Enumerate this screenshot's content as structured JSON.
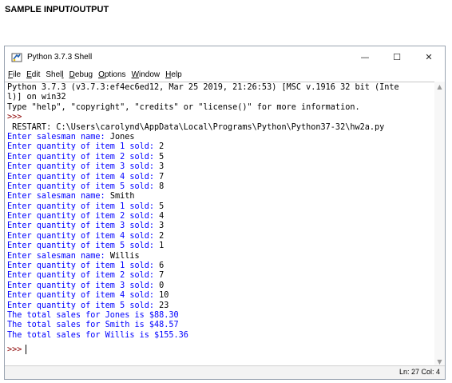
{
  "page_heading": "SAMPLE INPUT/OUTPUT",
  "window": {
    "title": "Python 3.7.3 Shell",
    "controls": {
      "minimize": "—",
      "maximize": "☐",
      "close": "✕"
    }
  },
  "menu": [
    {
      "u": "F",
      "rest": "ile"
    },
    {
      "u": "E",
      "rest": "dit"
    },
    {
      "u": "",
      "pre": "She",
      "u2": "l",
      "rest": "l"
    },
    {
      "u": "D",
      "rest": "ebug"
    },
    {
      "u": "O",
      "rest": "ptions"
    },
    {
      "u": "W",
      "rest": "indow"
    },
    {
      "u": "H",
      "rest": "elp"
    }
  ],
  "menu_labels": [
    "File",
    "Edit",
    "Shell",
    "Debug",
    "Options",
    "Window",
    "Help"
  ],
  "shell": {
    "lines": [
      {
        "t": "Python 3.7.3 (v3.7.3:ef4ec6ed12, Mar 25 2019, 21:26:53) [MSC v.1916 32 bit (Inte",
        "c": "black"
      },
      {
        "t": "l)] on win32",
        "c": "black"
      },
      {
        "t": "Type \"help\", \"copyright\", \"credits\" or \"license()\" for more information.",
        "c": "black"
      },
      {
        "t": ">>> ",
        "c": "prompt"
      },
      {
        "t": " RESTART: C:\\Users\\carolynd\\AppData\\Local\\Programs\\Python\\Python37-32\\hw2a.py",
        "c": "black"
      },
      {
        "p": "Enter salesman name: ",
        "v": "Jones"
      },
      {
        "p": "Enter quantity of item 1 sold: ",
        "v": "2"
      },
      {
        "p": "Enter quantity of item 2 sold: ",
        "v": "5"
      },
      {
        "p": "Enter quantity of item 3 sold: ",
        "v": "3"
      },
      {
        "p": "Enter quantity of item 4 sold: ",
        "v": "7"
      },
      {
        "p": "Enter quantity of item 5 sold: ",
        "v": "8"
      },
      {
        "p": "Enter salesman name: ",
        "v": "Smith"
      },
      {
        "p": "Enter quantity of item 1 sold: ",
        "v": "5"
      },
      {
        "p": "Enter quantity of item 2 sold: ",
        "v": "4"
      },
      {
        "p": "Enter quantity of item 3 sold: ",
        "v": "3"
      },
      {
        "p": "Enter quantity of item 4 sold: ",
        "v": "2"
      },
      {
        "p": "Enter quantity of item 5 sold: ",
        "v": "1"
      },
      {
        "p": "Enter salesman name: ",
        "v": "Willis"
      },
      {
        "p": "Enter quantity of item 1 sold: ",
        "v": "6"
      },
      {
        "p": "Enter quantity of item 2 sold: ",
        "v": "7"
      },
      {
        "p": "Enter quantity of item 3 sold: ",
        "v": "0"
      },
      {
        "p": "Enter quantity of item 4 sold: ",
        "v": "10"
      },
      {
        "p": "Enter quantity of item 5 sold: ",
        "v": "23"
      },
      {
        "t": "The total sales for Jones is $88.30",
        "c": "blue"
      },
      {
        "t": "The total sales for Smith is $48.57",
        "c": "blue"
      },
      {
        "t": "The total sales for Willis is $155.36",
        "c": "blue"
      }
    ],
    "current_prompt": ">>>"
  },
  "status": {
    "text": "Ln: 27  Col: 4"
  },
  "colors": {
    "output": "#0000ff",
    "prompt": "#8b0000",
    "input": "#000000"
  }
}
